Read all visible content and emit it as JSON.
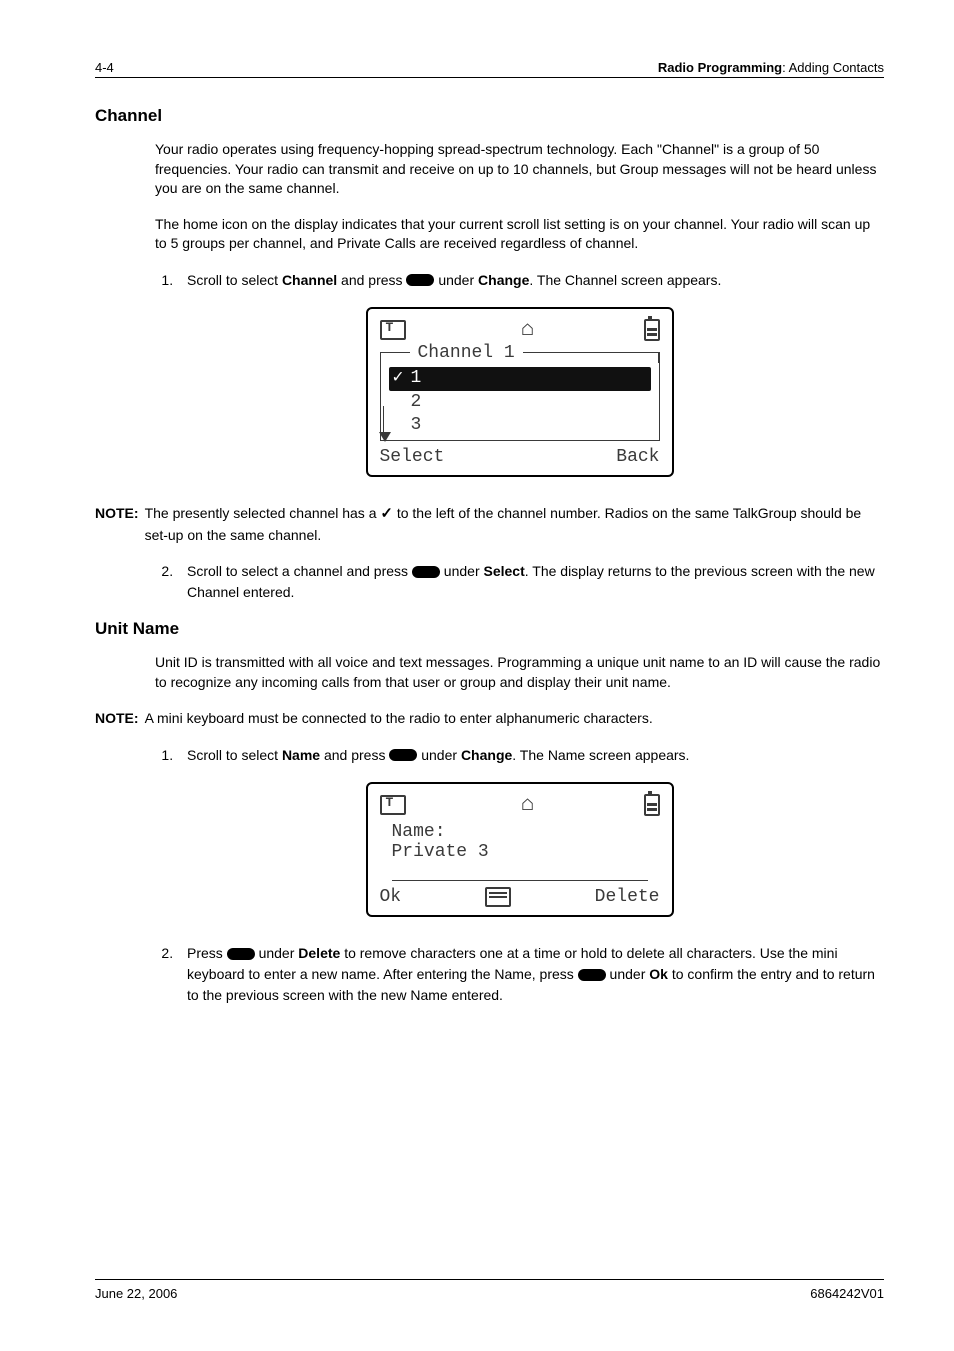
{
  "header": {
    "page_num": "4-4",
    "section_bold": "Radio Programming",
    "section_rest": ": Adding Contacts"
  },
  "channel": {
    "heading": "Channel",
    "para1": "Your radio operates using frequency-hopping spread-spectrum technology. Each \"Channel\" is a group of 50 frequencies. Your radio can transmit and receive on up to 10 channels, but Group messages will not be heard unless you are on the same channel.",
    "para2": "The home icon on the display indicates that your current scroll list setting is on your channel. Your radio will scan up to 5 groups per channel, and Private Calls are received regardless of channel.",
    "step1_a": "Scroll to select ",
    "step1_b": "Channel",
    "step1_c": " and press ",
    "step1_d": " under ",
    "step1_e": "Change",
    "step1_f": ". The Channel screen appears.",
    "lcd": {
      "title": "Channel 1",
      "rows": [
        "1",
        "2",
        "3"
      ],
      "soft_left": "Select",
      "soft_right": "Back"
    },
    "note_label": "NOTE:",
    "note_a": "The presently selected channel has a ",
    "note_b": " to the left of the channel number. Radios on the same TalkGroup should be set-up on the same channel.",
    "step2_a": "Scroll to select a channel and press ",
    "step2_b": " under ",
    "step2_c": "Select",
    "step2_d": ". The display returns to the previous screen with the new Channel entered."
  },
  "unitname": {
    "heading": "Unit Name",
    "para1": "Unit ID is transmitted with all voice and text messages. Programming a unique unit name to an ID will cause the radio to recognize any incoming calls from that user or group and display their unit name.",
    "note_label": "NOTE:",
    "note_text": "A mini keyboard must be connected to the radio to enter alphanumeric characters.",
    "step1_a": "Scroll to select ",
    "step1_b": "Name",
    "step1_c": " and press ",
    "step1_d": " under ",
    "step1_e": "Change",
    "step1_f": ". The Name screen appears.",
    "lcd": {
      "line1": "Name:",
      "line2": "Private 3",
      "soft_left": "Ok",
      "soft_right": "Delete"
    },
    "step2_a": "Press ",
    "step2_b": " under ",
    "step2_c": "Delete",
    "step2_d": " to remove characters one at a time or hold to delete all characters. Use the mini keyboard to enter a new name. After entering the Name, press ",
    "step2_e": " under ",
    "step2_f": "Ok",
    "step2_g": " to confirm the entry and to return to the previous screen with the new Name entered."
  },
  "footer": {
    "left": "June 22, 2006",
    "right": "6864242V01"
  }
}
